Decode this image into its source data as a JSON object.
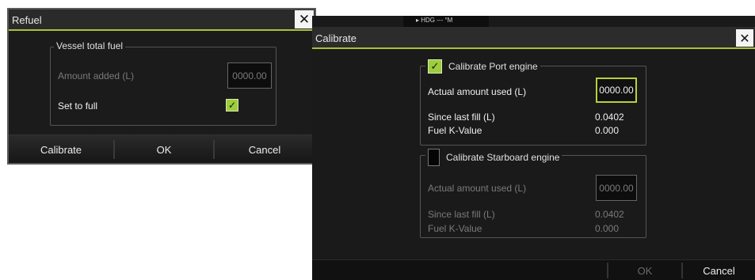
{
  "refuel": {
    "title": "Refuel",
    "group_title": "Vessel total fuel",
    "amount_label": "Amount added (L)",
    "amount_value": "0000.00",
    "set_full_label": "Set to full",
    "set_full_checked": true,
    "buttons": {
      "calibrate": "Calibrate",
      "ok": "OK",
      "cancel": "Cancel"
    }
  },
  "calibrate": {
    "status_text": "▸ HDG --- °M",
    "title": "Calibrate",
    "port": {
      "label": "Calibrate Port engine",
      "checked": true,
      "actual_label": "Actual amount used (L)",
      "actual_value": "0000.00",
      "since_label": "Since last fill (L)",
      "since_value": "0.0402",
      "kvalue_label": "Fuel K-Value",
      "kvalue_value": "0.000"
    },
    "starboard": {
      "label": "Calibrate Starboard engine",
      "checked": false,
      "actual_label": "Actual amount used (L)",
      "actual_value": "0000.00",
      "since_label": "Since last fill (L)",
      "since_value": "0.0402",
      "kvalue_label": "Fuel K-Value",
      "kvalue_value": "0.000"
    },
    "buttons": {
      "ok": "OK",
      "cancel": "Cancel"
    }
  },
  "icons": {
    "close": "close-icon",
    "check": "check-icon"
  },
  "colors": {
    "accent": "#a7c23a",
    "check": "#9ccd3c",
    "background": "#1a1a1a"
  }
}
